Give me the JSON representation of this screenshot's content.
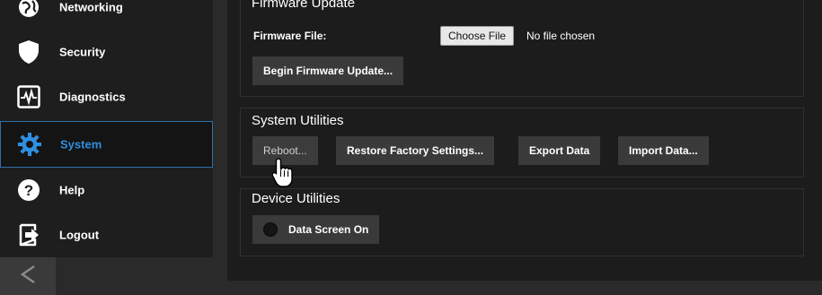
{
  "sidebar": {
    "items": [
      {
        "label": "Networking",
        "icon": "globe-icon"
      },
      {
        "label": "Security",
        "icon": "shield-icon"
      },
      {
        "label": "Diagnostics",
        "icon": "pulse-icon"
      },
      {
        "label": "System",
        "icon": "gear-icon",
        "active": true
      },
      {
        "label": "Help",
        "icon": "help-icon"
      },
      {
        "label": "Logout",
        "icon": "logout-icon"
      }
    ],
    "collapse_icon": "chevron-left-icon",
    "accent_color": "#2f8fe0"
  },
  "firmware": {
    "title": "Firmware Update",
    "file_label": "Firmware File:",
    "choose_file_label": "Choose File",
    "no_file_text": "No file chosen",
    "begin_button": "Begin Firmware Update..."
  },
  "system_utilities": {
    "title": "System Utilities",
    "reboot_button": "Reboot...",
    "restore_button": "Restore Factory Settings...",
    "export_button": "Export Data",
    "import_button": "Import Data..."
  },
  "device_utilities": {
    "title": "Device Utilities",
    "data_screen_button": "Data Screen On"
  }
}
